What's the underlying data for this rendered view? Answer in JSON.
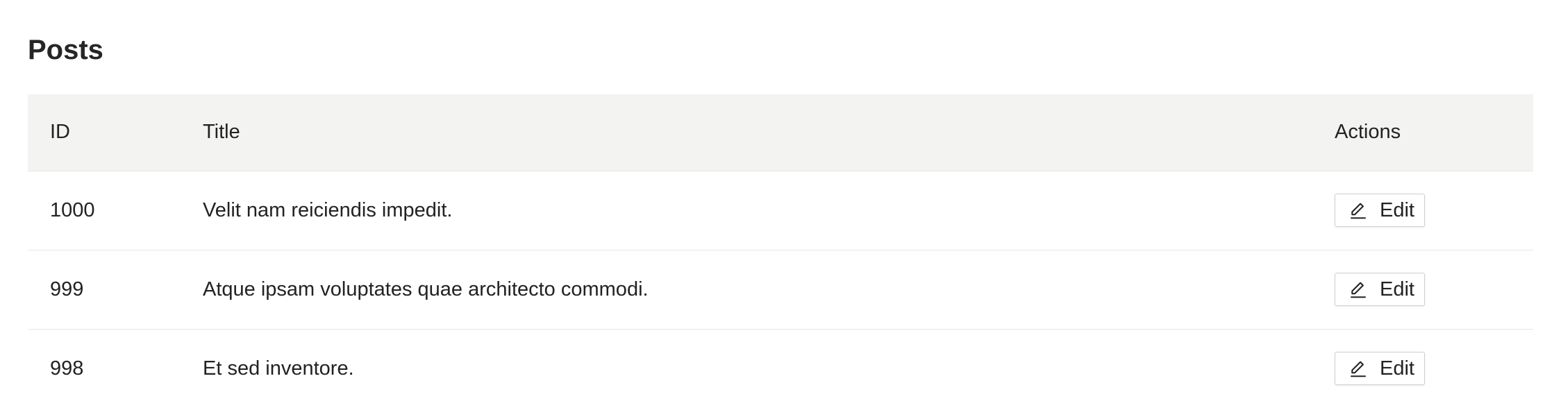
{
  "page": {
    "title": "Posts"
  },
  "table": {
    "columns": {
      "id": "ID",
      "title": "Title",
      "actions": "Actions"
    },
    "rows": [
      {
        "id": "1000",
        "title": "Velit nam reiciendis impedit.",
        "action_label": "Edit"
      },
      {
        "id": "999",
        "title": "Atque ipsam voluptates quae architecto commodi.",
        "action_label": "Edit"
      },
      {
        "id": "998",
        "title": "Et sed inventore.",
        "action_label": "Edit"
      }
    ]
  },
  "icons": {
    "edit": "pencil-icon"
  },
  "colors": {
    "header_background": "#f3f3f2",
    "row_divider": "#e6e6e4",
    "text": "#222222",
    "button_border": "#cfcfcf"
  }
}
